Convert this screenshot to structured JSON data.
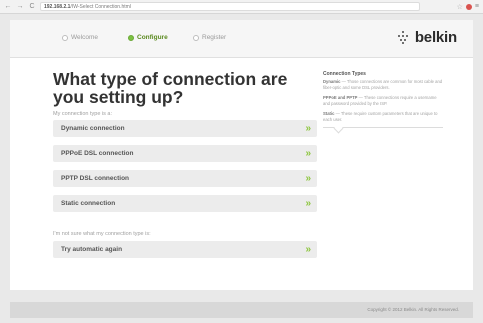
{
  "browser": {
    "back": "←",
    "forward": "→",
    "reload": "C",
    "url_host": "192.168.2.1",
    "url_path": "/IW-Select Connection.html"
  },
  "steps": [
    {
      "label": "Welcome"
    },
    {
      "label": "Configure"
    },
    {
      "label": "Register"
    }
  ],
  "brand": {
    "name": "belkin"
  },
  "headline": "What type of connection are you setting up?",
  "connection_prompt": "My connection type is a:",
  "options": [
    {
      "label": "Dynamic connection",
      "arrow": "»"
    },
    {
      "label": "PPPoE DSL connection",
      "arrow": "»"
    },
    {
      "label": "PPTP DSL connection",
      "arrow": "»"
    },
    {
      "label": "Static connection",
      "arrow": "»"
    }
  ],
  "unsure_prompt": "I'm not sure what my connection type is:",
  "retry": {
    "label": "Try automatic again",
    "arrow": "»"
  },
  "help": {
    "title": "Connection Types",
    "items": [
      {
        "term": "Dynamic",
        "text": " — Those connections are common for most cable and fiber-optic and some DSL providers."
      },
      {
        "term": "PPPoE and PPTP",
        "text": " — These connections require a username and password provided by the ISP."
      },
      {
        "term": "Static",
        "text": " — These require custom parameters that are unique to each user."
      }
    ]
  },
  "footer": {
    "copyright": "Copyright © 2012 Belkin. All Rights Reserved."
  },
  "colors": {
    "accent": "#7cc242",
    "arrow": "#8dc63f",
    "button_bg": "#ececec"
  }
}
